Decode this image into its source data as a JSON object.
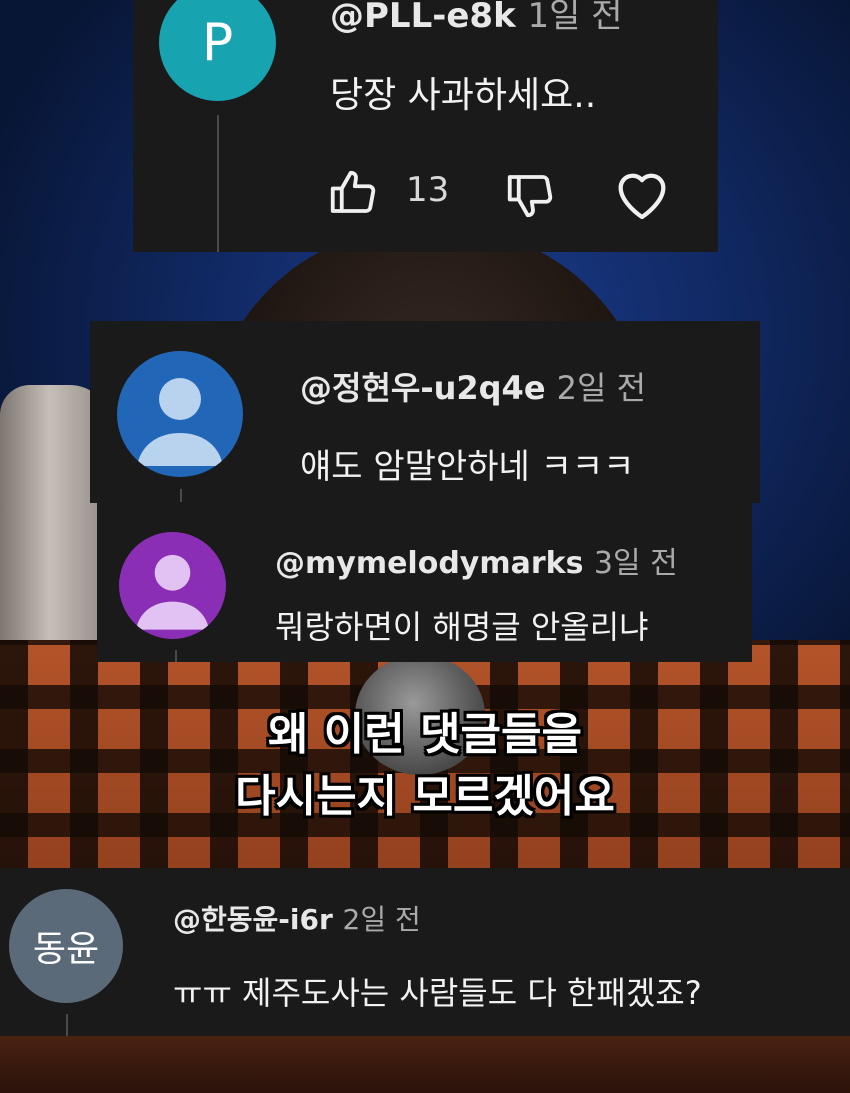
{
  "comments": [
    {
      "handle": "@PLL-e8k",
      "time": "1일 전",
      "avatar_letter": "P",
      "avatar_color": "#17a3b0",
      "text": "당장 사과하세요..",
      "likes": "13"
    },
    {
      "handle": "@정현우-u2q4e",
      "time": "2일 전",
      "avatar_color": "#2266b8",
      "text": "얘도 암말안하네 ㅋㅋㅋ"
    },
    {
      "handle": "@mymelodymarks",
      "time": "3일 전",
      "avatar_color": "#8a2fb5",
      "text": "뭐랑하면이 해명글 안올리냐"
    },
    {
      "handle": "@한동윤-i6r",
      "time": "2일 전",
      "avatar_letter": "동윤",
      "avatar_color": "#5b6a78",
      "text": "ㅠㅠ 제주도사는 사람들도 다 한패겠죠?"
    }
  ],
  "caption": {
    "line1": "왜 이런 댓글들을",
    "line2": "다시는지 모르겠어요"
  },
  "icons": {
    "like": "thumbs-up-icon",
    "dislike": "thumbs-down-icon",
    "heart": "heart-icon",
    "person": "person-silhouette-icon"
  }
}
